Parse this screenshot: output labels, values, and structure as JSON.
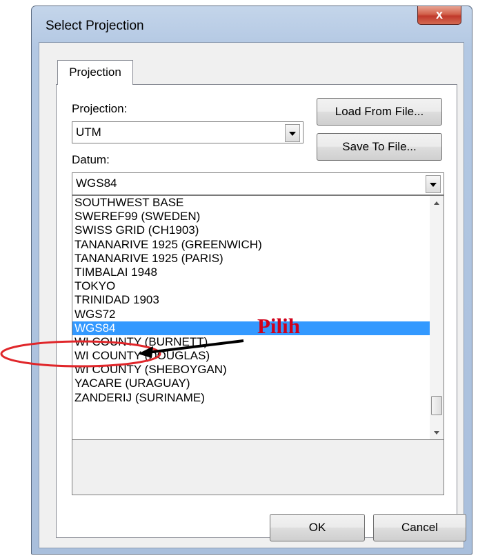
{
  "window": {
    "title": "Select Projection",
    "close_label": "x"
  },
  "tabs": [
    {
      "label": "Projection"
    }
  ],
  "projection": {
    "label": "Projection:",
    "value": "UTM"
  },
  "datum": {
    "label": "Datum:",
    "value": "WGS84",
    "items": [
      "SOUTHWEST BASE",
      "SWEREF99 (SWEDEN)",
      "SWISS GRID (CH1903)",
      "TANANARIVE 1925 (GREENWICH)",
      "TANANARIVE 1925 (PARIS)",
      "TIMBALAI 1948",
      "TOKYO",
      "TRINIDAD 1903",
      "WGS72",
      "WGS84",
      "WI COUNTY (BURNETT)",
      "WI COUNTY (DOUGLAS)",
      "WI COUNTY (SHEBOYGAN)",
      "YACARE (URAGUAY)",
      "ZANDERIJ (SURINAME)"
    ],
    "selected_index": 9
  },
  "buttons": {
    "load": "Load From File...",
    "save": "Save To File...",
    "ok": "OK",
    "cancel": "Cancel"
  },
  "annotation": {
    "text": "Pilih",
    "color": "#d0021b"
  },
  "colors": {
    "selection": "#3399ff",
    "close": "#c0392b"
  }
}
